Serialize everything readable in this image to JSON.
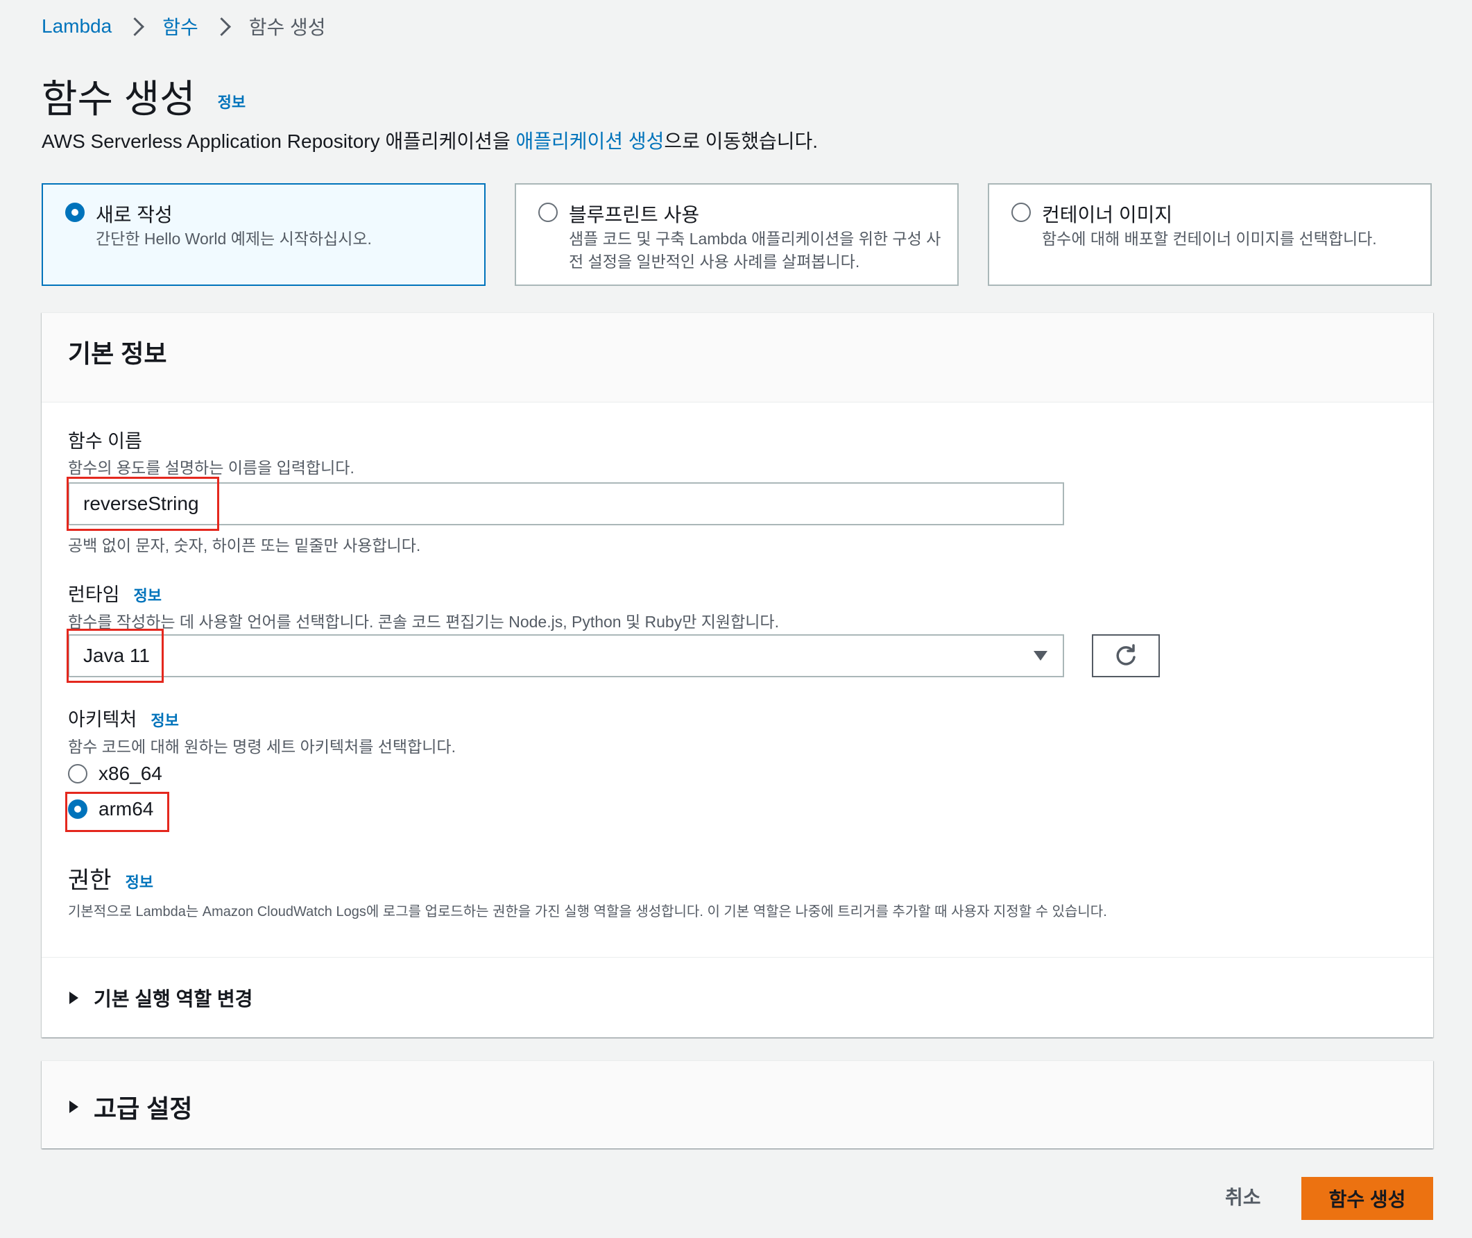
{
  "breadcrumb": {
    "root": "Lambda",
    "parent": "함수",
    "current": "함수 생성"
  },
  "page": {
    "title": "함수 생성",
    "info": "정보",
    "subtitle_prefix": "AWS Serverless Application Repository 애플리케이션을 ",
    "subtitle_link": "애플리케이션 생성",
    "subtitle_suffix": "으로 이동했습니다."
  },
  "options": [
    {
      "title": "새로 작성",
      "desc": "간단한 Hello World 예제는 시작하십시오.",
      "selected": true
    },
    {
      "title": "블루프린트 사용",
      "desc": "샘플 코드 및 구축 Lambda 애플리케이션을 위한 구성 사전 설정을 일반적인 사용 사례를 살펴봅니다.",
      "selected": false
    },
    {
      "title": "컨테이너 이미지",
      "desc": "함수에 대해 배포할 컨테이너 이미지를 선택합니다.",
      "selected": false
    }
  ],
  "basic": {
    "header": "기본 정보",
    "function_name": {
      "label": "함수 이름",
      "desc": "함수의 용도를 설명하는 이름을 입력합니다.",
      "value": "reverseString",
      "hint": "공백 없이 문자, 숫자, 하이픈 또는 밑줄만 사용합니다."
    },
    "runtime": {
      "label": "런타임",
      "info": "정보",
      "desc": "함수를 작성하는 데 사용할 언어를 선택합니다. 콘솔 코드 편집기는 Node.js, Python 및 Ruby만 지원합니다.",
      "value": "Java 11"
    },
    "architecture": {
      "label": "아키텍처",
      "info": "정보",
      "desc": "함수 코드에 대해 원하는 명령 세트 아키텍처를 선택합니다.",
      "options": [
        "x86_64",
        "arm64"
      ],
      "selected": "arm64"
    },
    "permissions": {
      "title": "권한",
      "info": "정보",
      "desc": "기본적으로 Lambda는 Amazon CloudWatch Logs에 로그를 업로드하는 권한을 가진 실행 역할을 생성합니다. 이 기본 역할은 나중에 트리거를 추가할 때 사용자 지정할 수 있습니다."
    },
    "change_role": "기본 실행 역할 변경"
  },
  "advanced": {
    "title": "고급 설정"
  },
  "footer": {
    "cancel": "취소",
    "create": "함수 생성"
  },
  "colors": {
    "accent": "#0073bb",
    "primary_button": "#ec7211",
    "highlight_box": "#e4281e"
  }
}
